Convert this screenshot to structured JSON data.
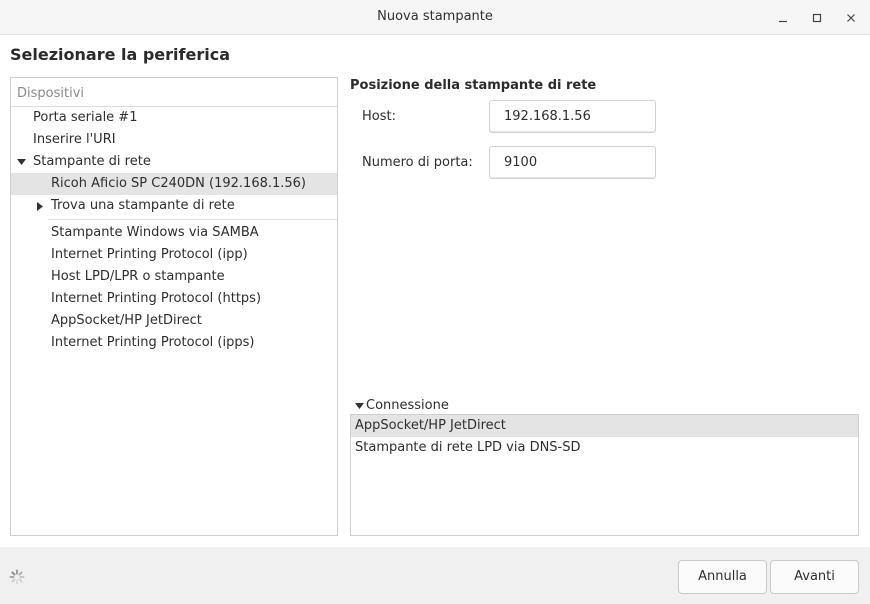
{
  "window": {
    "title": "Nuova stampante",
    "controls": {
      "minimize": "minimize-icon",
      "maximize": "maximize-icon",
      "close": "close-icon"
    }
  },
  "heading": "Selezionare la periferica",
  "devices": {
    "header": "Dispositivi",
    "items": [
      {
        "label": "Porta seriale #1"
      },
      {
        "label": "Inserire l'URI"
      },
      {
        "label": "Stampante di rete"
      },
      {
        "label": "Ricoh Aficio SP C240DN (192.168.1.56)"
      },
      {
        "label": "Trova una stampante di rete"
      },
      {
        "label": "Stampante Windows via SAMBA"
      },
      {
        "label": "Internet Printing Protocol (ipp)"
      },
      {
        "label": "Host LPD/LPR o stampante"
      },
      {
        "label": "Internet Printing Protocol (https)"
      },
      {
        "label": "AppSocket/HP JetDirect"
      },
      {
        "label": "Internet Printing Protocol (ipps)"
      }
    ]
  },
  "network": {
    "title": "Posizione della stampante di rete",
    "host_label": "Host:",
    "host_value": "192.168.1.56",
    "port_label": "Numero di porta:",
    "port_value": "9100"
  },
  "connection": {
    "label": "Connessione",
    "items": [
      {
        "label": "AppSocket/HP JetDirect"
      },
      {
        "label": "Stampante di rete LPD via DNS-SD"
      }
    ]
  },
  "footer": {
    "cancel_label": "Annulla",
    "next_label": "Avanti"
  },
  "colors": {
    "selection": "#e4e4e4",
    "footer_bg": "#f0f0f0",
    "titlebar_bg": "#f6f6f6"
  }
}
